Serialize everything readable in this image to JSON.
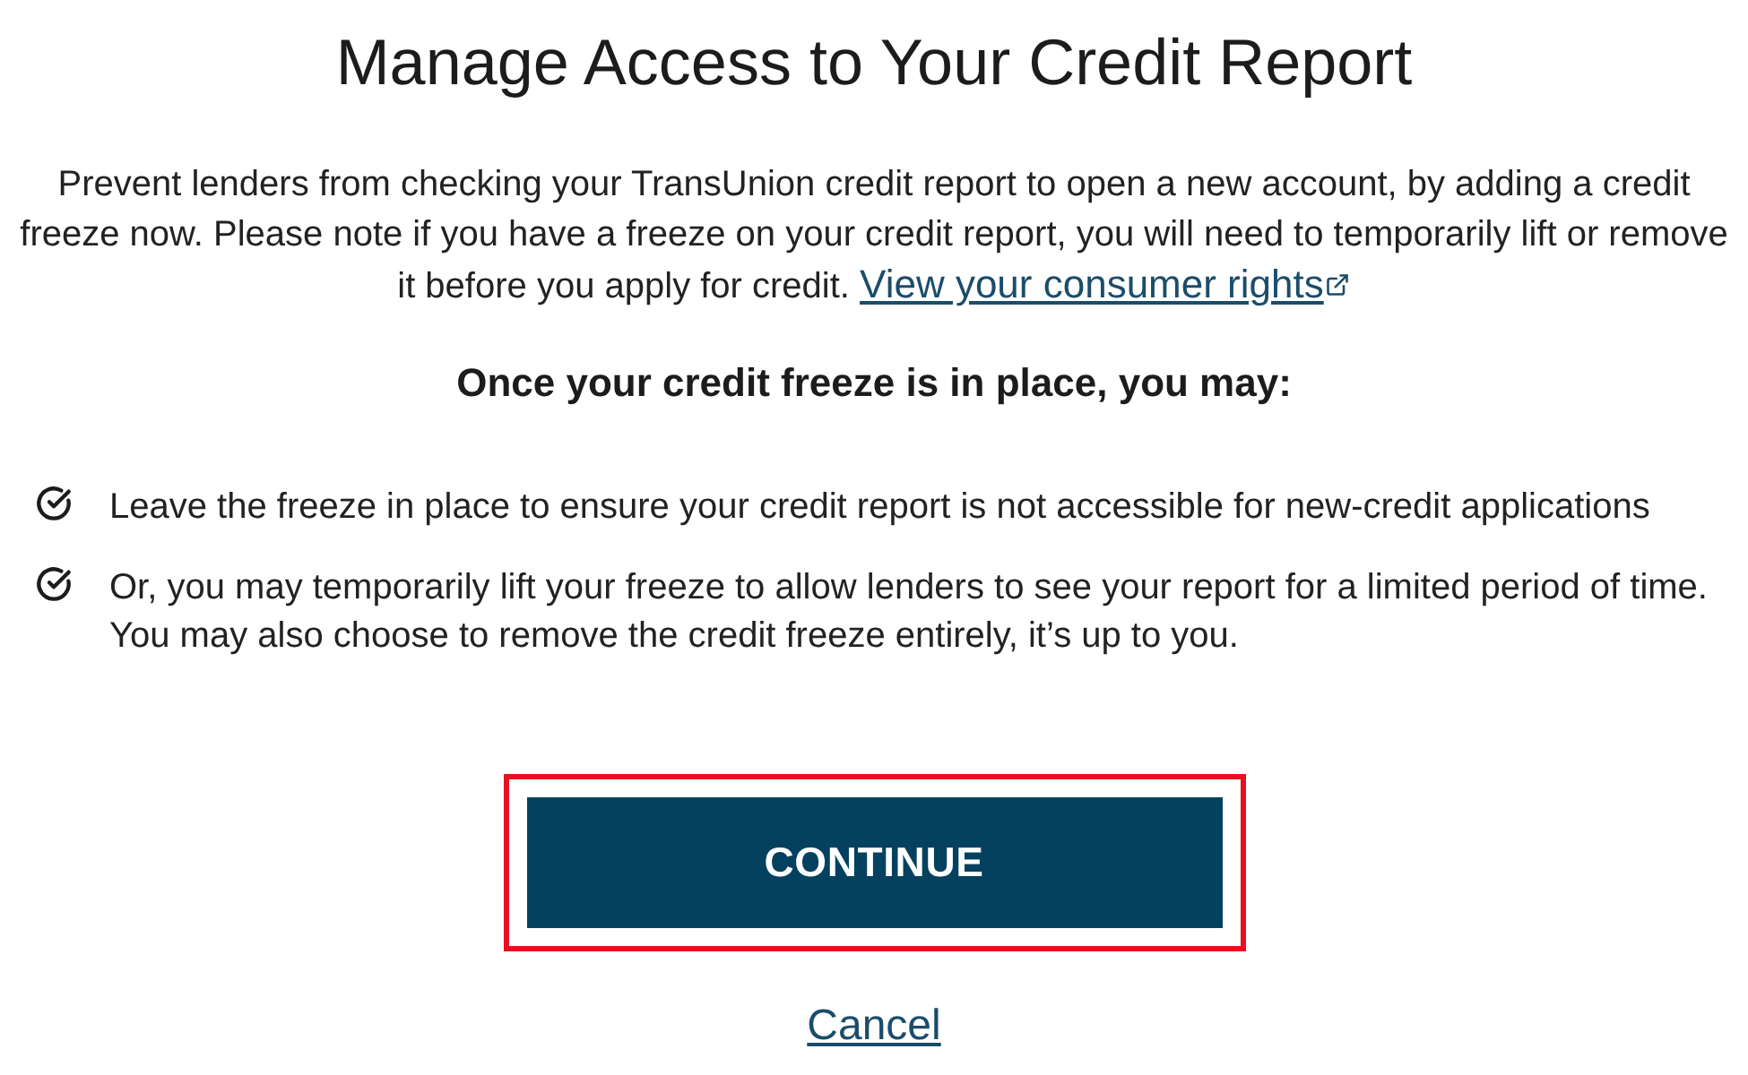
{
  "title": "Manage Access to Your Credit Report",
  "intro": {
    "text": "Prevent lenders from checking your TransUnion credit report to open a new account, by adding a credit freeze now. Please note if you have a freeze on your credit report, you will need to temporarily lift or remove it before you apply for credit.",
    "link": {
      "label": "View your consumer rights",
      "external": true
    }
  },
  "subheading": "Once your credit freeze is in place, you may:",
  "options": [
    {
      "text": "Leave the freeze in place to ensure your credit report is not accessible for new-credit applications"
    },
    {
      "text": "Or, you may temporarily lift your freeze to allow lenders to see your report for a limited period of time. You may also choose to remove the credit freeze entirely, it’s up to you."
    }
  ],
  "continue_button": {
    "label": "CONTINUE",
    "highlighted": true
  },
  "cancel_link": "Cancel"
}
